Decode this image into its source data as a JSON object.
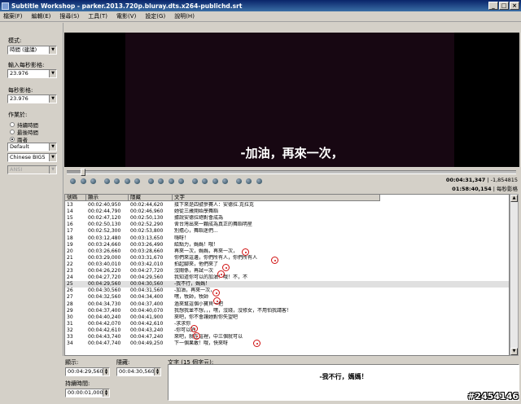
{
  "window": {
    "title": "Subtitle Workshop - parker.2013.720p.bluray.dts.x264-publichd.srt"
  },
  "menu": [
    "檔案(F)",
    "編輯(E)",
    "搜尋(S)",
    "工具(T)",
    "電影(V)",
    "設定(G)",
    "說明(H)"
  ],
  "left": {
    "mode_label": "模式:",
    "mode_value": "時間 (建議)",
    "input_fps_label": "輸入每秒影格:",
    "input_fps_value": "23.976",
    "fps_label": "每秒影格:",
    "fps_value": "23.976",
    "work_label": "作業於:",
    "radio_1": "持續時間",
    "radio_2": "最後時間",
    "radio_3": "兩者",
    "combo_style": "Default",
    "combo_charset": "Chinese BIG5",
    "combo_disabled": "ANSI"
  },
  "video": {
    "subtitle": "-加油，再來一次，",
    "time_current": "00:04:31,347",
    "time_total": "01:58:40,154",
    "delay": "-1,854815",
    "fps_label": "每秒影格"
  },
  "progress": 0.03,
  "grid": {
    "headers": [
      "號碼",
      "顯示",
      "隱藏",
      "文字"
    ],
    "rows": [
      [
        "13",
        "00:02:40,950",
        "00:02:44,620",
        "接下來是四號參賽人：安德拉.克拉克"
      ],
      [
        "14",
        "00:02:44,790",
        "00:02:46,960",
        "她從三歲開始學舞蹈"
      ],
      [
        "15",
        "00:02:47,120",
        "00:02:50,130",
        "據說安德拉絕對會成為"
      ],
      [
        "16",
        "00:02:50,130",
        "00:02:52,290",
        "舍台灣出來一顆成為真正的舞蹈明星"
      ],
      [
        "17",
        "00:02:52,300",
        "00:02:53,800",
        "別擔心，舞蹈迷們..."
      ],
      [
        "18",
        "00:03:12,480",
        "00:03:13,650",
        "嗨呀！"
      ],
      [
        "19",
        "00:03:24,660",
        "00:03:26,490",
        "給點力，媽媽！哦！"
      ],
      [
        "20",
        "00:03:26,660",
        "00:03:28,660",
        "再來一次，媽媽，再來一次，"
      ],
      [
        "21",
        "00:03:29,000",
        "00:03:31,670",
        "你們來這邊，你們所有人，你們所有人"
      ],
      [
        "22",
        "00:03:40,010",
        "00:03:42,010",
        "拍起腳來，他們來了"
      ],
      [
        "23",
        "00:04:26,220",
        "00:04:27,720",
        "沒關係，再試一次"
      ],
      [
        "24",
        "00:04:27,720",
        "00:04:29,560",
        "我知道你可以的加油！哦！不，不"
      ],
      [
        "25",
        "00:04:29,560",
        "00:04:30,560",
        "-我不行，媽媽！"
      ],
      [
        "26",
        "00:04:30,560",
        "00:04:31,560",
        "-加油，再來一次，"
      ],
      [
        "27",
        "00:04:32,560",
        "00:04:34,400",
        "嘿，牧師，牧師"
      ],
      [
        "28",
        "00:04:34,730",
        "00:04:37,400",
        "過來幫這個小寶貝一把"
      ],
      [
        "29",
        "00:04:37,400",
        "00:04:40,070",
        "我想我並不想，，，嘿，沒錢，沒修女，不用怕我請客！"
      ],
      [
        "30",
        "00:04:40,240",
        "00:04:41,900",
        "來吧，你不會讓她對你失望吧"
      ],
      [
        "31",
        "00:04:42,070",
        "00:04:42,610",
        "-求求你"
      ],
      [
        "32",
        "00:04:42,610",
        "00:04:43,240",
        "-你可以的"
      ],
      [
        "33",
        "00:04:43,740",
        "00:04:47,240",
        "來吧，就在這裡，中三個就可以"
      ],
      [
        "34",
        "00:04:47,740",
        "00:04:49,250",
        "下一個果敢！哦，快來呀"
      ]
    ]
  },
  "bottom": {
    "show_label": "顯示:",
    "show_value": "00:04:29,560",
    "hide_label": "隱藏:",
    "hide_value": "00:04:30,560",
    "duration_label": "持續時間:",
    "duration_value": "00:00:01,000",
    "text_label": "文字 (15 個字元):",
    "text_value": "-我不行，媽媽！"
  },
  "watermark": "#2454146"
}
